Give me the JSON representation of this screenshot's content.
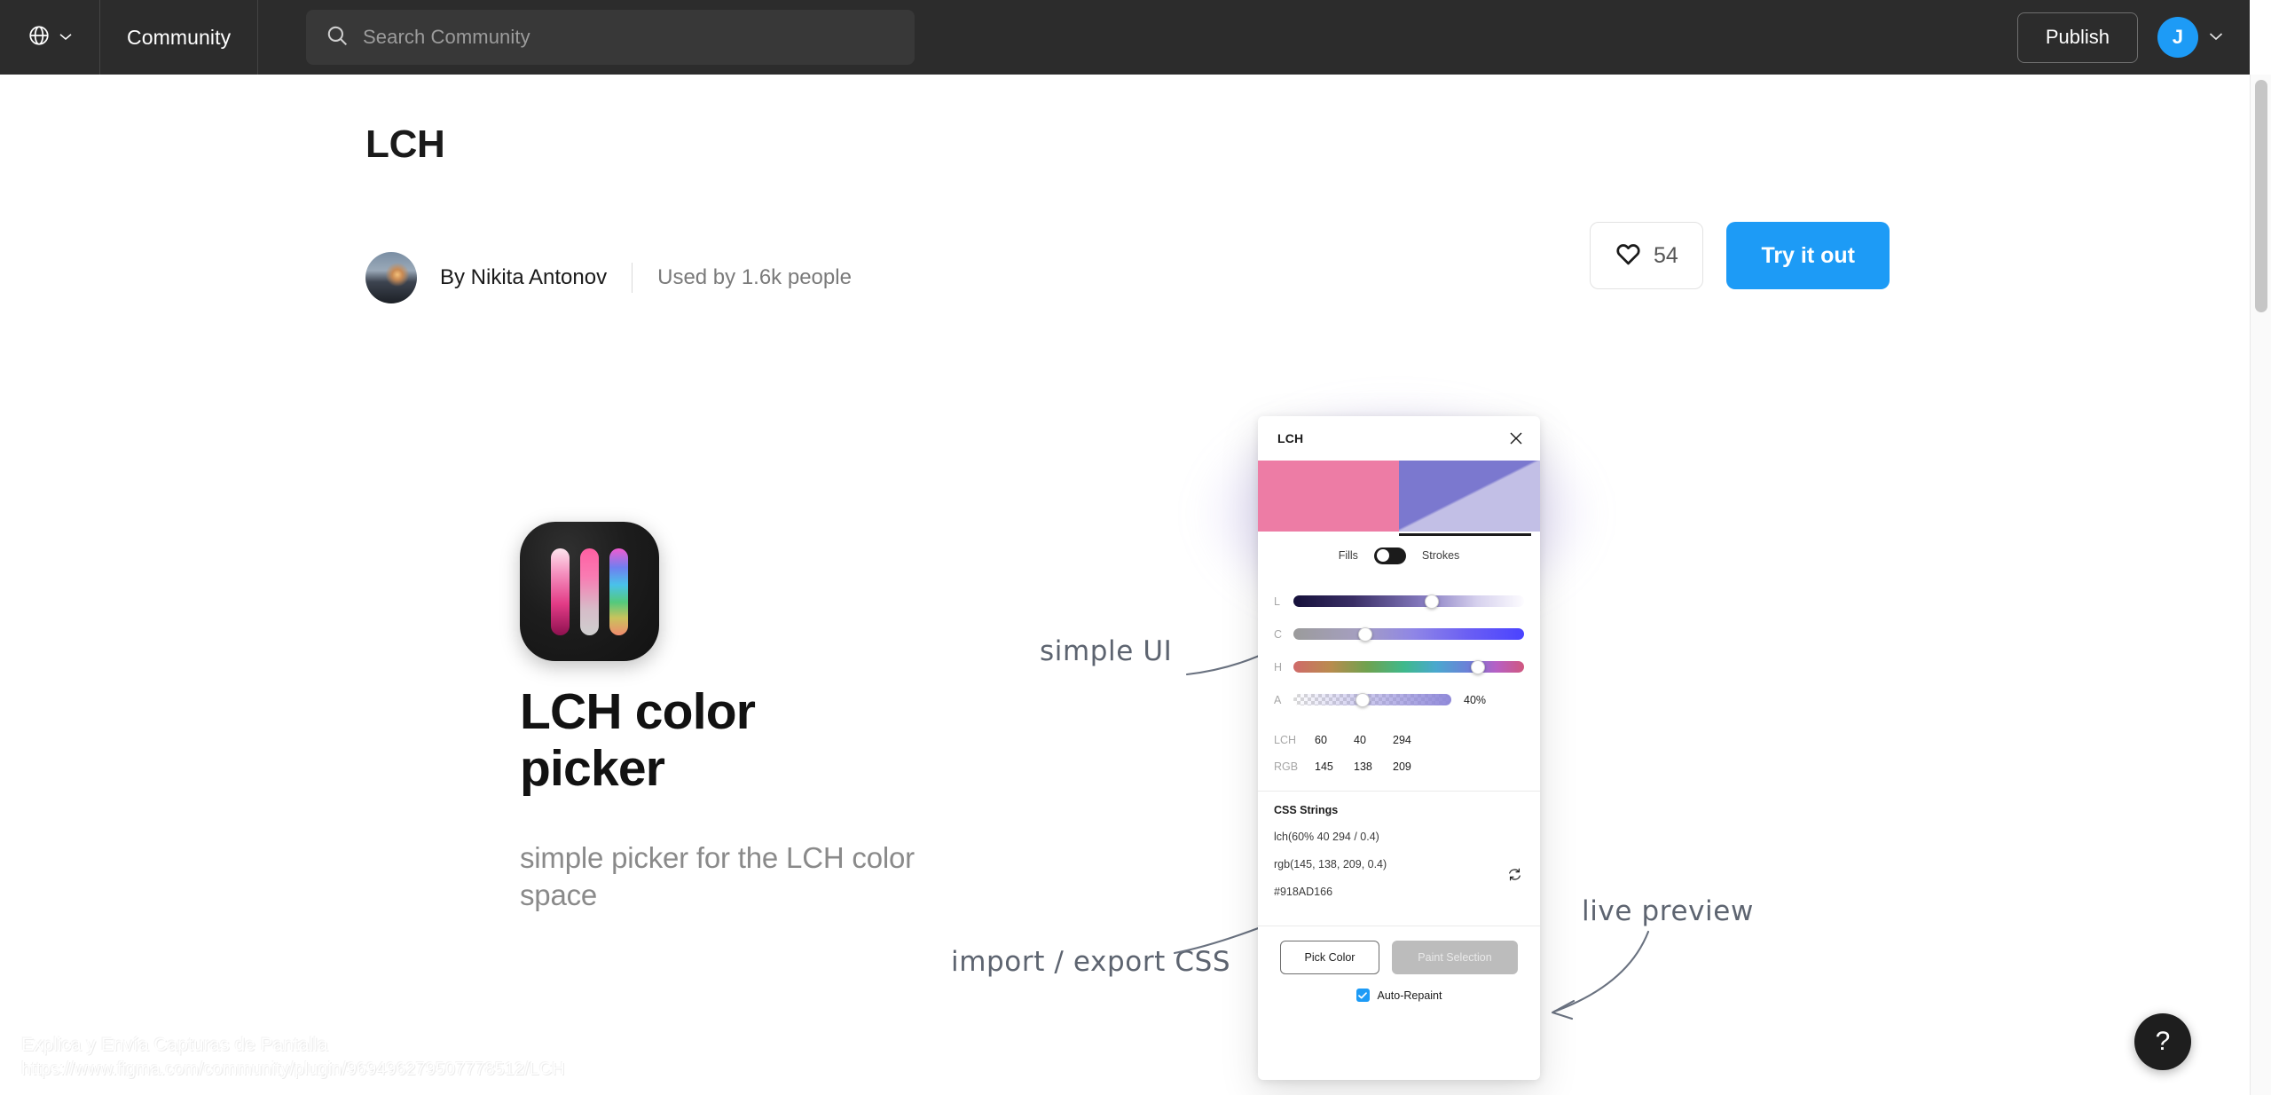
{
  "topbar": {
    "globe_icon": "globe-icon",
    "globe_chevron_icon": "chevron-down-icon",
    "community_label": "Community",
    "search": {
      "icon": "search-icon",
      "placeholder": "Search Community",
      "value": ""
    },
    "publish_label": "Publish",
    "avatar_initial": "J",
    "avatar_chevron_icon": "chevron-down-icon",
    "bg_color": "#2c2c2c"
  },
  "header": {
    "title": "LCH",
    "author_prefix": "By",
    "author_name": "By Nikita Antonov",
    "used_by": "Used by 1.6k people",
    "like": {
      "icon": "heart-icon",
      "count": "54"
    },
    "try_it_out_label": "Try it out",
    "accent_color": "#1d9bf6"
  },
  "promo": {
    "logo_icon": "lch-app-logo-icon",
    "heading": "LCH color picker",
    "subheading": "simple picker for the LCH color space"
  },
  "annotations": {
    "simple_ui": "simple UI",
    "import_export": "import / export CSS",
    "live_preview": "live preview"
  },
  "plugin_card": {
    "title": "LCH",
    "close_icon": "close-icon",
    "swatch_left_color": "#ed7ca5",
    "swatch_right_color": "#7b78cf",
    "mode": {
      "fills_label": "Fills",
      "strokes_label": "Strokes",
      "toggle_state": "strokes"
    },
    "sliders": [
      {
        "label": "L",
        "position_pct": 60,
        "name": "lightness"
      },
      {
        "label": "C",
        "position_pct": 31,
        "name": "chroma"
      },
      {
        "label": "H",
        "position_pct": 80,
        "name": "hue"
      },
      {
        "label": "A",
        "position_pct": 44,
        "name": "alpha",
        "value_text": "40%"
      }
    ],
    "value_rows": [
      {
        "label": "LCH",
        "cells": [
          "60",
          "40",
          "294"
        ]
      },
      {
        "label": "RGB",
        "cells": [
          "145",
          "138",
          "209"
        ]
      }
    ],
    "css": {
      "title": "CSS Strings",
      "lch": "lch(60% 40 294 / 0.4)",
      "rgb": "rgb(145, 138, 209, 0.4)",
      "hex": "#918AD166",
      "refresh_icon": "refresh-icon"
    },
    "footer": {
      "pick_color_label": "Pick Color",
      "paint_selection_label": "Paint Selection",
      "auto_repaint_label": "Auto-Repaint",
      "auto_repaint_checked": true,
      "check_icon": "check-icon"
    }
  },
  "watermark": {
    "line1": "Explica y Envía Capturas de Pantalla",
    "line2": "https://www.figma.com/community/plugin/969496279507778512/LCH"
  },
  "help": {
    "label": "?",
    "icon": "question-mark-icon"
  }
}
